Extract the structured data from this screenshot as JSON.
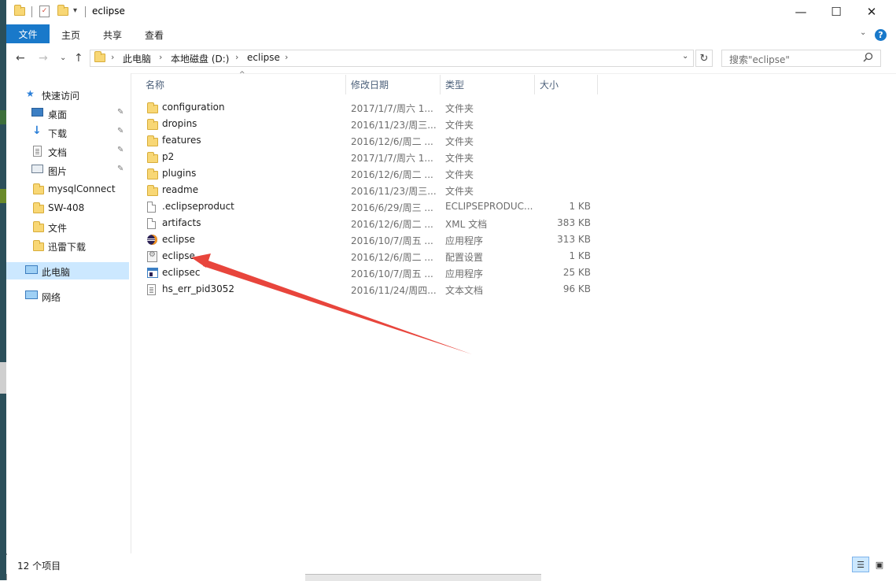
{
  "window": {
    "title": "eclipse",
    "minimize_glyph": "—",
    "maximize_glyph": "☐",
    "close_glyph": "✕"
  },
  "ribbon": {
    "tabs": [
      "文件",
      "主页",
      "共享",
      "查看"
    ],
    "help_glyph": "?",
    "toggle_glyph": "⌄",
    "active_tab_color": "#1979ca"
  },
  "address": {
    "back_glyph": "←",
    "forward_glyph": "→",
    "recent_glyph": "⌄",
    "up_glyph": "↑",
    "crumbs": [
      "此电脑",
      "本地磁盘 (D:)",
      "eclipse"
    ],
    "separator": "›",
    "dropdown_glyph": "⌄",
    "refresh_glyph": "↻"
  },
  "search": {
    "placeholder": "搜索\"eclipse\"",
    "icon": "search-icon"
  },
  "nav_pane": {
    "quick_access": "快速访问",
    "items": [
      {
        "label": "桌面",
        "icon": "desktop-icon",
        "pinned": true
      },
      {
        "label": "下载",
        "icon": "download-icon",
        "pinned": true
      },
      {
        "label": "文档",
        "icon": "document-icon",
        "pinned": true
      },
      {
        "label": "图片",
        "icon": "picture-icon",
        "pinned": true
      },
      {
        "label": "mysqlConnect",
        "icon": "folder-icon",
        "pinned": false
      },
      {
        "label": "SW-408",
        "icon": "folder-icon",
        "pinned": false
      },
      {
        "label": "文件",
        "icon": "folder-icon",
        "pinned": false
      },
      {
        "label": "迅雷下载",
        "icon": "folder-icon",
        "pinned": false
      }
    ],
    "this_pc": "此电脑",
    "network": "网络",
    "pin_glyph": "📌"
  },
  "columns": {
    "name": "名称",
    "date": "修改日期",
    "type": "类型",
    "size": "大小",
    "sort_glyph": "^"
  },
  "files": [
    {
      "name": "configuration",
      "date": "2017/1/7/周六 1...",
      "type": "文件夹",
      "size": "",
      "icon": "folder-icon"
    },
    {
      "name": "dropins",
      "date": "2016/11/23/周三...",
      "type": "文件夹",
      "size": "",
      "icon": "folder-icon"
    },
    {
      "name": "features",
      "date": "2016/12/6/周二 ...",
      "type": "文件夹",
      "size": "",
      "icon": "folder-icon"
    },
    {
      "name": "p2",
      "date": "2017/1/7/周六 1...",
      "type": "文件夹",
      "size": "",
      "icon": "folder-icon"
    },
    {
      "name": "plugins",
      "date": "2016/12/6/周二 ...",
      "type": "文件夹",
      "size": "",
      "icon": "folder-icon"
    },
    {
      "name": "readme",
      "date": "2016/11/23/周三...",
      "type": "文件夹",
      "size": "",
      "icon": "folder-icon"
    },
    {
      "name": ".eclipseproduct",
      "date": "2016/6/29/周三 ...",
      "type": "ECLIPSEPRODUC...",
      "size": "1 KB",
      "icon": "file-icon"
    },
    {
      "name": "artifacts",
      "date": "2016/12/6/周二 ...",
      "type": "XML 文档",
      "size": "383 KB",
      "icon": "file-icon"
    },
    {
      "name": "eclipse",
      "date": "2016/10/7/周五 ...",
      "type": "应用程序",
      "size": "313 KB",
      "icon": "eclipse-app-icon"
    },
    {
      "name": "eclipse",
      "date": "2016/12/6/周二 ...",
      "type": "配置设置",
      "size": "1 KB",
      "icon": "config-file-icon"
    },
    {
      "name": "eclipsec",
      "date": "2016/10/7/周五 ...",
      "type": "应用程序",
      "size": "25 KB",
      "icon": "console-app-icon"
    },
    {
      "name": "hs_err_pid3052",
      "date": "2016/11/24/周四...",
      "type": "文本文档",
      "size": "96 KB",
      "icon": "text-file-icon"
    }
  ],
  "status": {
    "item_count": "12 个项目",
    "details_view_glyph": "☰",
    "tiles_view_glyph": "▣"
  },
  "annotation": {
    "arrow_color": "#e8453c"
  }
}
